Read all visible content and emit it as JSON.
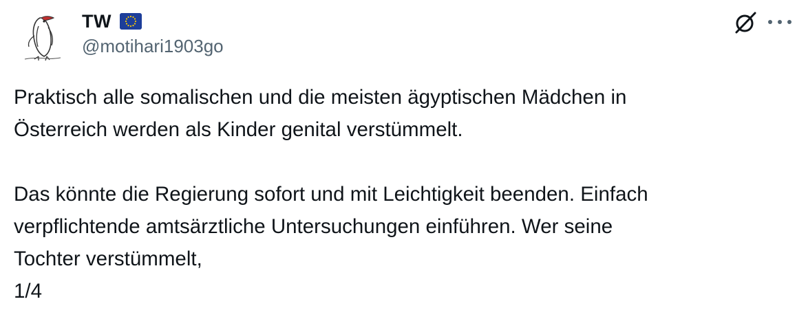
{
  "author": {
    "display_name": "TW",
    "handle": "@motihari1903go",
    "flag_icon": "eu-flag-icon",
    "avatar_icon": "penguin-avatar-icon"
  },
  "actions": {
    "grok_icon": "grok-icon",
    "more_icon": "more-options-icon"
  },
  "tweet": {
    "lines_paragraph_1": [
      "Praktisch alle somalischen und die meisten ägyptischen Mädchen in",
      "Österreich werden als Kinder genital verstümmelt."
    ],
    "lines_paragraph_2": [
      "Das könnte die Regierung sofort und mit Leichtigkeit beenden. Einfach",
      "verpflichtende amtsärztliche Untersuchungen einführen. Wer seine",
      "Tochter verstümmelt,",
      "1/4"
    ]
  },
  "colors": {
    "text_primary": "#0f1419",
    "text_secondary": "#536471",
    "eu_blue": "#1d3e9a",
    "eu_gold": "#ffcc00"
  }
}
